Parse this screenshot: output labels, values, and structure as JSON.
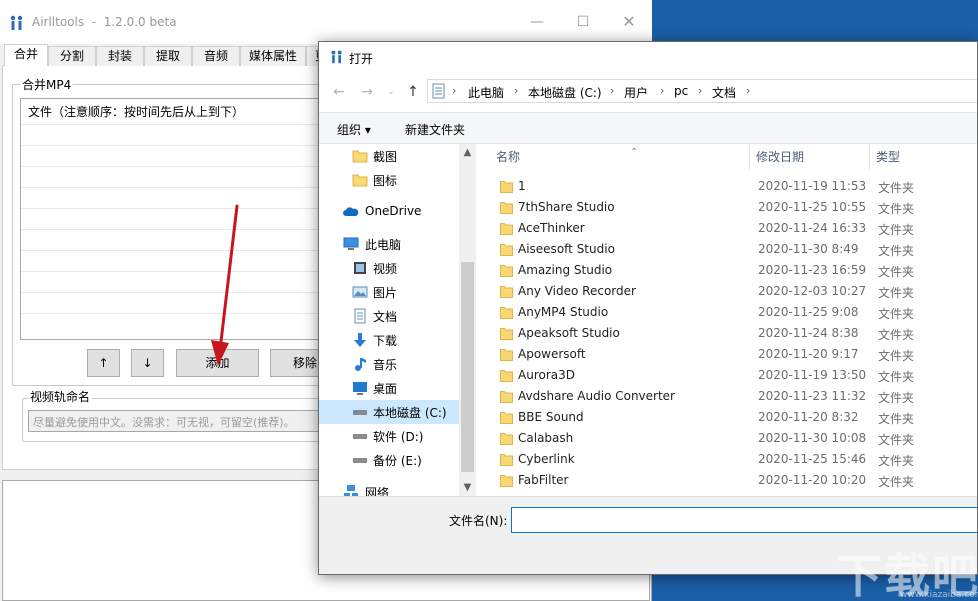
{
  "app": {
    "title": "Airlltools  -  1.2.0.0 beta",
    "tabs": [
      "合并",
      "分割",
      "封装",
      "提取",
      "音频",
      "媒体属性",
      "更"
    ],
    "merge_group_legend": "合并MP4",
    "file_list_header": "文件（注意顺序：按时间先后从上到下）",
    "up_arrow": "↑",
    "down_arrow": "↓",
    "add_button": "添加",
    "remove_button": "移除",
    "video_track_legend": "视频轨命名",
    "video_track_placeholder": "尽量避免使用中文。没需求：可无视，可留空(推荐)。"
  },
  "dialog": {
    "title": "打开",
    "address_path": [
      "此电脑",
      "本地磁盘 (C:)",
      "用户",
      "pc",
      "文档"
    ],
    "organize_label": "组织 ▾",
    "new_folder_label": "新建文件夹",
    "nav_items": [
      {
        "label": "截图",
        "icon": "folder-icon"
      },
      {
        "label": "图标",
        "icon": "folder-icon"
      },
      {
        "label": "OneDrive",
        "icon": "cloud-icon"
      },
      {
        "label": "此电脑",
        "icon": "computer-icon"
      },
      {
        "label": "视频",
        "icon": "video-icon"
      },
      {
        "label": "图片",
        "icon": "pictures-icon"
      },
      {
        "label": "文档",
        "icon": "documents-icon"
      },
      {
        "label": "下载",
        "icon": "download-icon"
      },
      {
        "label": "音乐",
        "icon": "music-icon"
      },
      {
        "label": "桌面",
        "icon": "desktop-icon"
      },
      {
        "label": "本地磁盘 (C:)",
        "icon": "drive-icon"
      },
      {
        "label": "软件 (D:)",
        "icon": "drive-icon"
      },
      {
        "label": "备份 (E:)",
        "icon": "drive-icon"
      },
      {
        "label": "网络",
        "icon": "network-icon"
      }
    ],
    "selected_nav": "本地磁盘 (C:)",
    "columns": {
      "name": "名称",
      "date": "修改日期",
      "type": "类型"
    },
    "files": [
      {
        "name": "1",
        "date": "2020-11-19 11:53",
        "type": "文件夹"
      },
      {
        "name": "7thShare Studio",
        "date": "2020-11-25 10:55",
        "type": "文件夹"
      },
      {
        "name": "AceThinker",
        "date": "2020-11-24 16:33",
        "type": "文件夹"
      },
      {
        "name": "Aiseesoft Studio",
        "date": "2020-11-30 8:49",
        "type": "文件夹"
      },
      {
        "name": "Amazing Studio",
        "date": "2020-11-23 16:59",
        "type": "文件夹"
      },
      {
        "name": "Any Video Recorder",
        "date": "2020-12-03 10:27",
        "type": "文件夹"
      },
      {
        "name": "AnyMP4 Studio",
        "date": "2020-11-25 9:08",
        "type": "文件夹"
      },
      {
        "name": "Apeaksoft Studio",
        "date": "2020-11-24 8:38",
        "type": "文件夹"
      },
      {
        "name": "Apowersoft",
        "date": "2020-11-20 9:17",
        "type": "文件夹"
      },
      {
        "name": "Aurora3D",
        "date": "2020-11-19 13:50",
        "type": "文件夹"
      },
      {
        "name": "Avdshare Audio Converter",
        "date": "2020-11-23 11:32",
        "type": "文件夹"
      },
      {
        "name": "BBE Sound",
        "date": "2020-11-20 8:32",
        "type": "文件夹"
      },
      {
        "name": "Calabash",
        "date": "2020-11-30 10:08",
        "type": "文件夹"
      },
      {
        "name": "Cyberlink",
        "date": "2020-11-25 15:46",
        "type": "文件夹"
      },
      {
        "name": "FabFilter",
        "date": "2020-11-20 10:20",
        "type": "文件夹"
      }
    ],
    "filename_label": "文件名(N):",
    "filename_value": ""
  },
  "watermark": {
    "text": "下载吧",
    "sub": "www.xiazaiba.com"
  },
  "colors": {
    "selection": "#cce8ff",
    "folder": "#f8d775",
    "accent": "#0078d7",
    "arrow": "#c8161d"
  }
}
